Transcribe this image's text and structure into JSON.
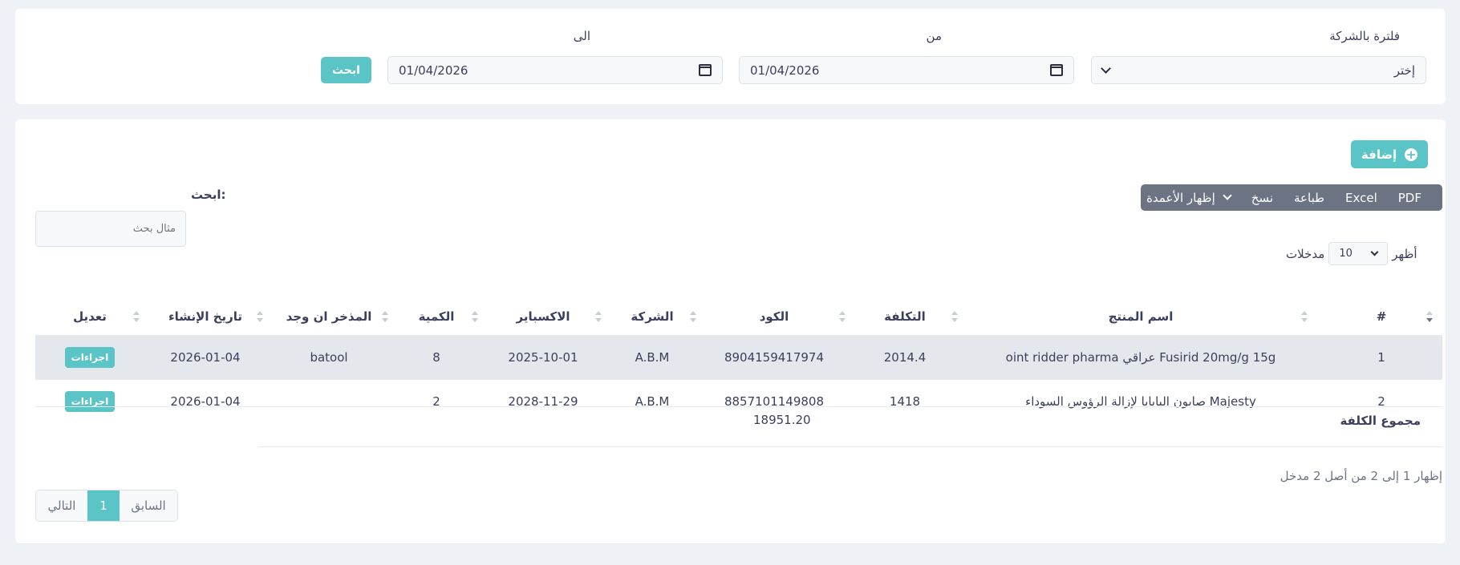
{
  "filter": {
    "company_label": "فلترة بالشركة",
    "company_value": "إختر",
    "from_label": "من",
    "from_value": "01/04/2026",
    "to_label": "الى",
    "to_value": "01/04/2026",
    "search_button": "ابحث"
  },
  "actions": {
    "add_label": "إضافة"
  },
  "toolbar": {
    "pdf": "PDF",
    "excel": "Excel",
    "print": "طباعة",
    "copy": "نسخ",
    "colvis": "إظهار الأعمدة"
  },
  "search": {
    "label": "ابحث:",
    "placeholder": "مثال بحث"
  },
  "length": {
    "show": "أظهر",
    "value": "10",
    "entries": "مدخلات"
  },
  "table": {
    "headers": [
      "#",
      "اسم المنتج",
      "التكلفة",
      "الكود",
      "الشركة",
      "الاكسباير",
      "الكمية",
      "المذخر ان وجد",
      "تاريخ الإنشاء",
      "تعديل"
    ],
    "rows": [
      {
        "num": "1",
        "name": "oint ridder pharma عراقي Fusirid 20mg/g 15g",
        "cost": "2014.4",
        "code": "8904159417974",
        "company": "A.B.M",
        "expiry": "2025-10-01",
        "qty": "8",
        "supplier": "batool",
        "created": "2026-01-04",
        "action": "اجراءات"
      },
      {
        "num": "2",
        "name": "صابون البابايا لإزالة الرؤوس السوداء Majesty",
        "cost": "1418",
        "code": "8857101149808",
        "company": "A.B.M",
        "expiry": "2028-11-29",
        "qty": "2",
        "supplier": "",
        "created": "2026-01-04",
        "action": "اجراءات"
      }
    ],
    "total_label": "مجموع الكلفة",
    "total_value": "18951.20"
  },
  "info": "إظهار 1 إلى 2 من أصل 2 مدخل",
  "pagination": {
    "prev": "السابق",
    "current": "1",
    "next": "التالي"
  },
  "colors": {
    "accent": "#5bc4c6",
    "toolbar": "#6c7484",
    "background": "#eef1f6"
  }
}
